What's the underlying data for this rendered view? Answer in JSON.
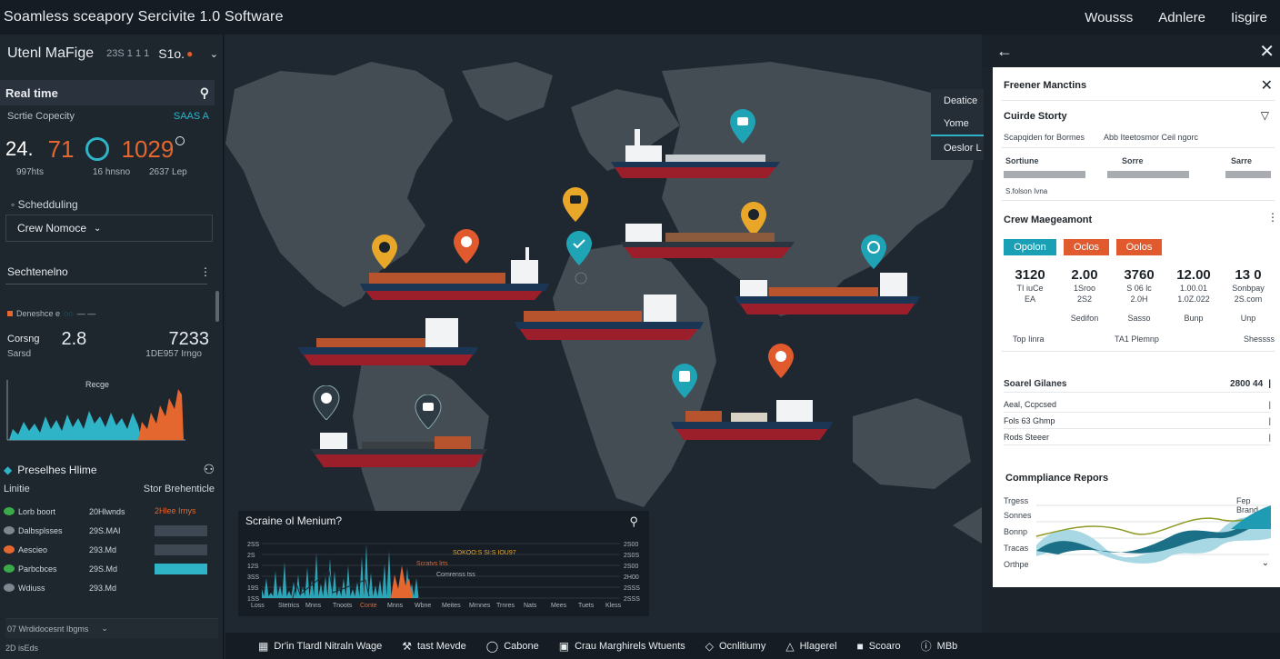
{
  "app": {
    "title": "Soamless sceapory Sercivite 1.0 Software",
    "nav": [
      "Wousss",
      "Adnlere",
      "Iisgire"
    ]
  },
  "left": {
    "header": {
      "title": "Utenl MaFige",
      "mid": "23S 1 1 1",
      "selector": "S1o."
    },
    "realtime": {
      "label": "Real time"
    },
    "capacity": {
      "label": "Scrtie Copecity",
      "value": "SAAS A"
    },
    "kpis": {
      "v1": "24.",
      "v2": "71",
      "v3": "1029"
    },
    "kpi_sub": [
      "997hts",
      "16 hnsno",
      "2637 Lep"
    ],
    "scheduling": {
      "label": "Schedduling",
      "dropdown": "Crew Nomoce"
    },
    "section": {
      "title": "Sechtenelno",
      "small_label": "Deneshce e"
    },
    "stat": {
      "label": "Corsng",
      "v1": "2.8",
      "v2": "7233",
      "sub_left": "Sarsd",
      "sub_right": "1DE957 Irngo"
    },
    "mini_chart": {
      "label": "Recge"
    },
    "preshes": {
      "title": "Preselhes Hlime",
      "col_left": "Linitie",
      "col_right": "Stor Brehenticle",
      "rows": [
        {
          "name": "Lorb boort",
          "value": "20Hlwnds",
          "tag": "2Hlee Irnys",
          "dot": "#3aaa4a",
          "bar": ""
        },
        {
          "name": "Dalbsplsses",
          "value": "29S.MAI",
          "tag": "",
          "dot": "#7c8790",
          "bar": "#3d4852"
        },
        {
          "name": "Aescieo",
          "value": "293.Md",
          "tag": "",
          "dot": "#e3672f",
          "bar": "#3d4852"
        },
        {
          "name": "Parbcbces",
          "value": "29S.Md",
          "tag": "",
          "dot": "#3aaa4a",
          "bar": "#2fb4c7"
        },
        {
          "name": "Wdiuss",
          "value": "293.Md",
          "tag": "",
          "dot": "#7c8790",
          "bar": ""
        }
      ],
      "footer": "07 Wrdidocesnt Ibgms"
    },
    "bottom_label": "2D isEds"
  },
  "map": {
    "legend": [
      "Deatice",
      "Yome",
      "Oeslor L"
    ]
  },
  "schedule_panel": {
    "title": "Scraine ol Menium?",
    "yticks": [
      "2SS",
      "2S",
      "12S",
      "3SS",
      "19S",
      "1SS"
    ],
    "yticks_right": [
      "2S00",
      "2S0S",
      "2S00",
      "2H00",
      "2SSS",
      "2SSS"
    ],
    "annotations": [
      "SOKOO:S SI:S IOU97",
      "Scratvs lrts",
      "Comrenss tss"
    ],
    "xticks": [
      "Loss",
      "Stetrics",
      "Mnns",
      "Tnoots",
      "Conte",
      "Mnns",
      "Wbne",
      "Meites",
      "Mrnnes",
      "Trnres",
      "Nats",
      "Mees",
      "Tuets",
      "Kless"
    ]
  },
  "right_panel": {
    "title": "Freener Manctins",
    "cuirde": {
      "title": "Cuirde Storty",
      "left": "Scapqiden for Bormes",
      "right": "Abb Iteetosmor Ceil ngorc"
    },
    "table_head": [
      "Sortiune",
      "Sorre",
      "Sarre"
    ],
    "small": "S.folson Ivna",
    "crew": {
      "title": "Crew Maegeamont",
      "tabs": [
        {
          "label": "Opolon",
          "color": "#1aa0b4"
        },
        {
          "label": "Oclos",
          "color": "#e05a2e"
        },
        {
          "label": "Oolos",
          "color": "#e05a2e"
        }
      ],
      "cols": [
        {
          "big": "3120",
          "s1": "TI iuCe",
          "s2": "EA",
          "lab": ""
        },
        {
          "big": "2.00",
          "s1": "1Sroo",
          "s2": "2S2",
          "lab": "Sedifon"
        },
        {
          "big": "3760",
          "s1": "S 06 lc",
          "s2": "2.0H",
          "lab": "Sasso"
        },
        {
          "big": "12.00",
          "s1": "1.00.01",
          "s2": "1.0Z.022",
          "lab": "Bunp"
        },
        {
          "big": "13 0",
          "s1": "Sonbpay",
          "s2": "2S.com",
          "lab": "Unp"
        }
      ],
      "foot": [
        "Top Iinra",
        "TA1 Plemnp",
        "Shessss"
      ]
    },
    "srows": [
      {
        "label": "Soarel Gilanes",
        "value": "2800 44"
      },
      {
        "label": "Aeal, Ccpcsed",
        "value": ""
      },
      {
        "label": "Fols 63 Ghmp",
        "value": ""
      },
      {
        "label": "Rods Steeer",
        "value": ""
      }
    ],
    "compliance": {
      "title": "Commpliance Repors",
      "ylabels": [
        "Trgess",
        "Sonnes",
        "Bonnp",
        "Tracas",
        "Orthpe"
      ],
      "right_label": "Fep Brand"
    }
  },
  "bottom_bar": {
    "items": [
      {
        "icon": "grid-icon",
        "label": "Dr'in Tlardl Nitraln Wage"
      },
      {
        "icon": "wrench-icon",
        "label": "tast Mevde"
      },
      {
        "icon": "pin-icon",
        "label": "Cabone"
      },
      {
        "icon": "doc-icon",
        "label": "Crau Marghirels Wtuents"
      },
      {
        "icon": "diamond-icon",
        "label": "Ocnlitiumy"
      },
      {
        "icon": "warning-icon",
        "label": "Hlagerel"
      },
      {
        "icon": "square-icon",
        "label": "Scoaro"
      },
      {
        "icon": "info-icon",
        "label": "MBb"
      }
    ]
  },
  "colors": {
    "teal": "#2fb4c7",
    "orange": "#e3672f",
    "yellow": "#e9a72a",
    "hull_red": "#9b1f2b",
    "hull_navy": "#1b3554"
  }
}
